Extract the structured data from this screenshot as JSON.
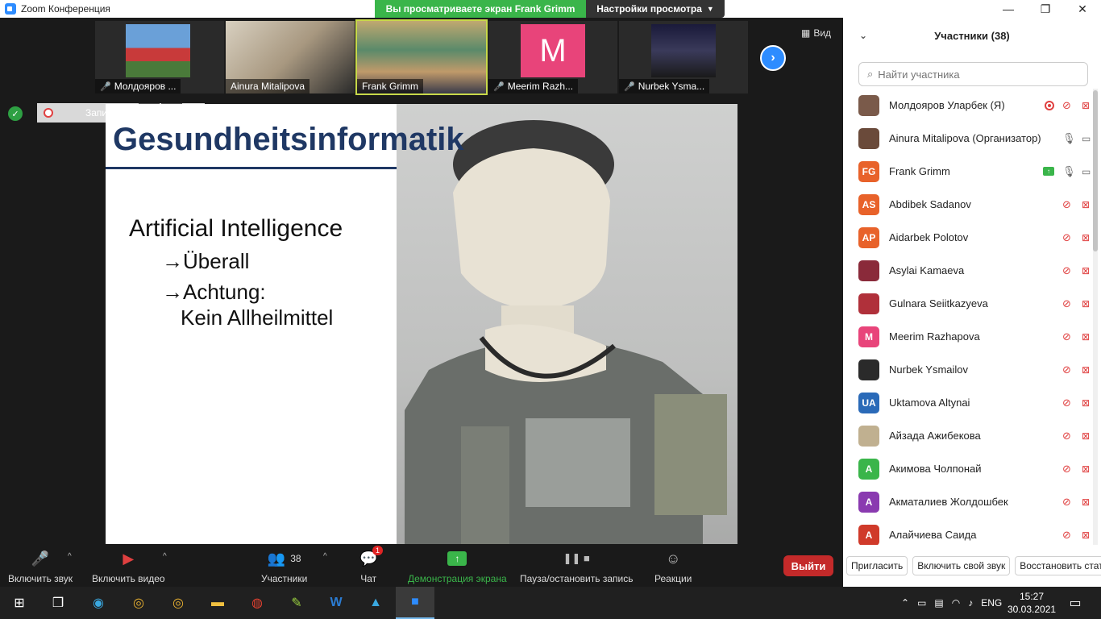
{
  "window": {
    "title": "Zoom Конференция",
    "share_banner": "Вы просматриваете экран Frank Grimm",
    "view_options": "Настройки просмотра",
    "minimize": "—",
    "maximize": "❐",
    "close": "✕"
  },
  "video_strip": {
    "tiles": [
      {
        "name": "Молдояров ...",
        "muted": true
      },
      {
        "name": "Ainura Mitalipova",
        "muted": false
      },
      {
        "name": "Frank Grimm",
        "muted": false
      },
      {
        "name": "Meerim Razh...",
        "muted": true,
        "initial": "M"
      },
      {
        "name": "Nurbek Ysma...",
        "muted": true
      }
    ],
    "view_label": "Вид"
  },
  "recording": {
    "label": "Запись..."
  },
  "slide": {
    "title": "Gesundheitsinformatik",
    "heading": "Artificial Intelligence",
    "bullet1": "→Überall",
    "bullet2": "→Achtung:",
    "bullet2_cont": "Kein Allheilmittel"
  },
  "toolbar": {
    "unmute": "Включить звук",
    "start_video": "Включить видео",
    "participants": "Участники",
    "participants_count": "38",
    "chat": "Чат",
    "chat_badge": "1",
    "share": "Демонстрация экрана",
    "pause_record": "Пауза/остановить запись",
    "reactions": "Реакции",
    "leave": "Выйти"
  },
  "panel": {
    "header": "Участники (38)",
    "search_placeholder": "Найти участника",
    "participants": [
      {
        "name": "Молдояров Уларбек (Я)",
        "avatar": "",
        "color": "#7a5a4a",
        "mic": "muted",
        "cam": "off",
        "rec": true
      },
      {
        "name": "Ainura Mitalipova (Организатор)",
        "avatar": "",
        "color": "#6a4a3a",
        "mic": "on",
        "cam": "on"
      },
      {
        "name": "Frank Grimm",
        "avatar": "FG",
        "color": "#e8622a",
        "mic": "on",
        "cam": "on",
        "share": true
      },
      {
        "name": "Abdibek Sadanov",
        "avatar": "AS",
        "color": "#e8622a",
        "mic": "muted",
        "cam": "off"
      },
      {
        "name": "Aidarbek Polotov",
        "avatar": "AP",
        "color": "#e8622a",
        "mic": "muted",
        "cam": "off"
      },
      {
        "name": "Asylai Kamaeva",
        "avatar": "",
        "color": "#8a2a3a",
        "mic": "muted",
        "cam": "off"
      },
      {
        "name": "Gulnara Seiitkazyeva",
        "avatar": "",
        "color": "#b0303a",
        "mic": "muted",
        "cam": "off"
      },
      {
        "name": "Meerim Razhapova",
        "avatar": "M",
        "color": "#e8447a",
        "mic": "muted",
        "cam": "off"
      },
      {
        "name": "Nurbek Ysmailov",
        "avatar": "",
        "color": "#2a2a2a",
        "mic": "muted",
        "cam": "off"
      },
      {
        "name": "Uktamova Altynai",
        "avatar": "UA",
        "color": "#2a6ab8",
        "mic": "muted",
        "cam": "off"
      },
      {
        "name": "Айзада Ажибекова",
        "avatar": "",
        "color": "#c0b090",
        "mic": "muted",
        "cam": "off"
      },
      {
        "name": "Акимова Чолпонай",
        "avatar": "А",
        "color": "#3ab54a",
        "mic": "muted",
        "cam": "off"
      },
      {
        "name": "Акматалиев Жолдошбек",
        "avatar": "А",
        "color": "#8a3ab0",
        "mic": "muted",
        "cam": "off"
      },
      {
        "name": "Алайчиева Саида",
        "avatar": "А",
        "color": "#d03a2a",
        "mic": "muted",
        "cam": "off"
      }
    ],
    "invite": "Пригласить",
    "unmute_me": "Включить свой звук",
    "reclaim": "Восстановить стату"
  },
  "taskbar": {
    "lang": "ENG",
    "time": "15:27",
    "date": "30.03.2021"
  },
  "colors": {
    "accent": "#2d8cff",
    "share_green": "#3ab54a",
    "leave_red": "#c42a2a",
    "slide_title": "#1f3864"
  }
}
